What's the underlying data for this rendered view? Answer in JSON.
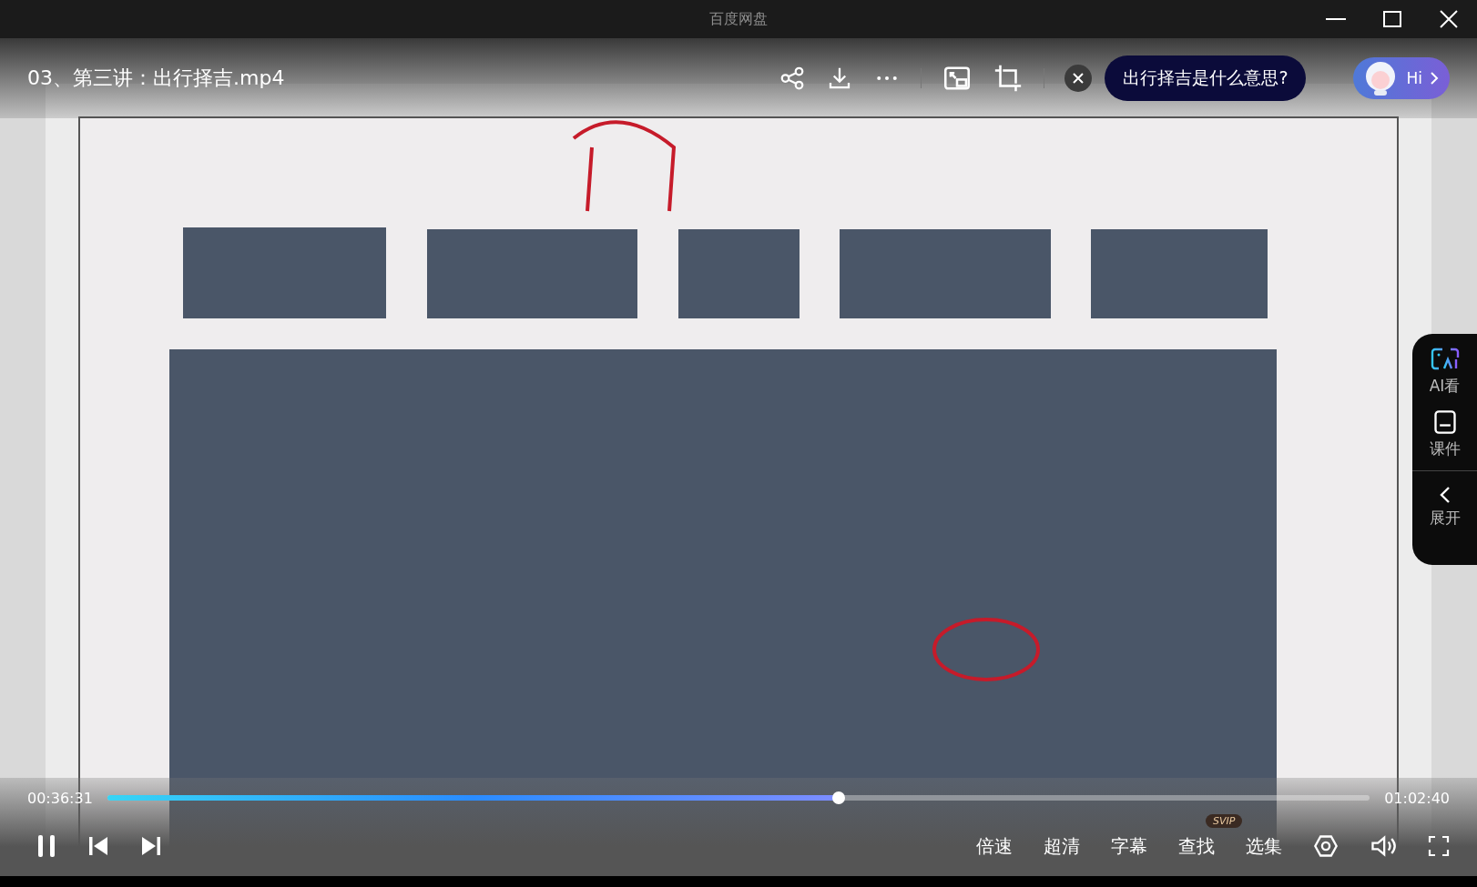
{
  "window": {
    "title": "百度网盘"
  },
  "player": {
    "file_title": "03、第三讲：出行择吉.mp4",
    "ai_question": "出行择吉是什么意思?",
    "assistant_label": "Hi"
  },
  "progress": {
    "current": "00:36:31",
    "total": "01:02:40",
    "level": 0.579
  },
  "controls": [
    {
      "label": "倍速"
    },
    {
      "label": "超清"
    },
    {
      "label": "字幕"
    },
    {
      "label": "查找",
      "badge": "SVIP"
    },
    {
      "label": "选集"
    }
  ],
  "side_panel": [
    {
      "kind": "ai",
      "label": "AI看"
    },
    {
      "kind": "courseware",
      "label": "课件"
    },
    {
      "kind": "expand",
      "label": "展开"
    }
  ]
}
